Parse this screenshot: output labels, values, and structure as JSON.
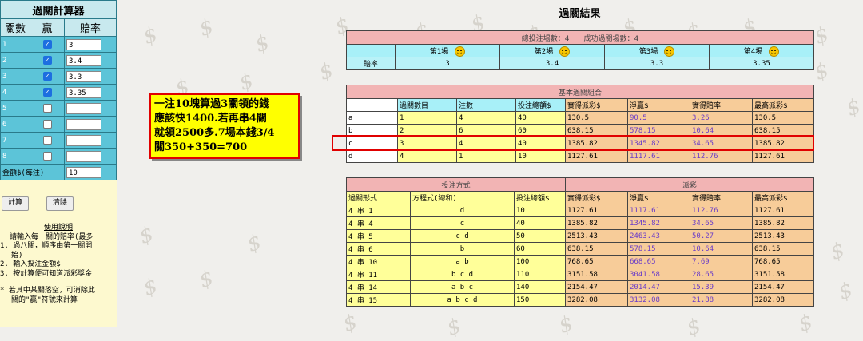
{
  "calculator": {
    "title": "過關計算器",
    "headers": {
      "count": "關數",
      "win": "贏",
      "odds": "賠率"
    },
    "rows": [
      {
        "n": "1",
        "checked": true,
        "odds": "3"
      },
      {
        "n": "2",
        "checked": true,
        "odds": "3.4"
      },
      {
        "n": "3",
        "checked": true,
        "odds": "3.3"
      },
      {
        "n": "4",
        "checked": true,
        "odds": "3.35"
      },
      {
        "n": "5",
        "checked": false,
        "odds": ""
      },
      {
        "n": "6",
        "checked": false,
        "odds": ""
      },
      {
        "n": "7",
        "checked": false,
        "odds": ""
      },
      {
        "n": "8",
        "checked": false,
        "odds": ""
      }
    ],
    "amount_label": "金額$(每注)",
    "amount_value": "10",
    "calc_button": "計算",
    "clear_button": "清除",
    "check_mark": "✓"
  },
  "help": {
    "title": "使用說明",
    "line1": "請輸入每一關的賠率(最多",
    "line2": "1. 過八關，順序由第一關開",
    "line3": "   始)",
    "line4": "2. 輸入投注金額$",
    "line5": "3. 按計算便可知道派彩獎金",
    "line6": "*   若其中某關落空，可消除此",
    "line7": "    關的\"贏\"符號來計算"
  },
  "note": {
    "line1": "一注10塊算過3關領的錢",
    "line2": "應該快1400.若再串4關",
    "line3": "就領2500多.7場本錢3/4",
    "line4": "關350+350=700"
  },
  "result": {
    "title": "過關結果",
    "summary": "總投注場數：4　　成功過關場數：4",
    "matches": [
      "第1場",
      "第2場",
      "第3場",
      "第4場"
    ],
    "odds_label": "賠率",
    "odds": [
      "3",
      "3.4",
      "3.3",
      "3.35"
    ]
  },
  "basic": {
    "title": "基本過關組合",
    "headers": [
      "過關數目",
      "注數",
      "投注總額$",
      "實得派彩$",
      "淨贏$",
      "實得賠率",
      "最高派彩$"
    ],
    "rows": [
      [
        "a",
        "1",
        "4",
        "40",
        "130.5",
        "90.5",
        "3.26",
        "130.5"
      ],
      [
        "b",
        "2",
        "6",
        "60",
        "638.15",
        "578.15",
        "10.64",
        "638.15"
      ],
      [
        "c",
        "3",
        "4",
        "40",
        "1385.82",
        "1345.82",
        "34.65",
        "1385.82"
      ],
      [
        "d",
        "4",
        "1",
        "10",
        "1127.61",
        "1117.61",
        "112.76",
        "1127.61"
      ]
    ]
  },
  "bet": {
    "title_left": "投注方式",
    "title_right": "派彩",
    "headers": [
      "過關形式",
      "方程式(總和)",
      "投注總額$",
      "實得派彩$",
      "淨贏$",
      "實得賠率",
      "最高派彩$"
    ],
    "rows": [
      [
        "4 串 1",
        "d",
        "10",
        "1127.61",
        "1117.61",
        "112.76",
        "1127.61"
      ],
      [
        "4 串 4",
        "c",
        "40",
        "1385.82",
        "1345.82",
        "34.65",
        "1385.82"
      ],
      [
        "4 串 5",
        "c d",
        "50",
        "2513.43",
        "2463.43",
        "50.27",
        "2513.43"
      ],
      [
        "4 串 6",
        "b",
        "60",
        "638.15",
        "578.15",
        "10.64",
        "638.15"
      ],
      [
        "4 串 10",
        "a b",
        "100",
        "768.65",
        "668.65",
        "7.69",
        "768.65"
      ],
      [
        "4 串 11",
        "b c d",
        "110",
        "3151.58",
        "3041.58",
        "28.65",
        "3151.58"
      ],
      [
        "4 串 14",
        "a b c",
        "140",
        "2154.47",
        "2014.47",
        "15.39",
        "2154.47"
      ],
      [
        "4 串 15",
        "a b c d",
        "150",
        "3282.08",
        "3132.08",
        "21.88",
        "3282.08"
      ]
    ]
  }
}
